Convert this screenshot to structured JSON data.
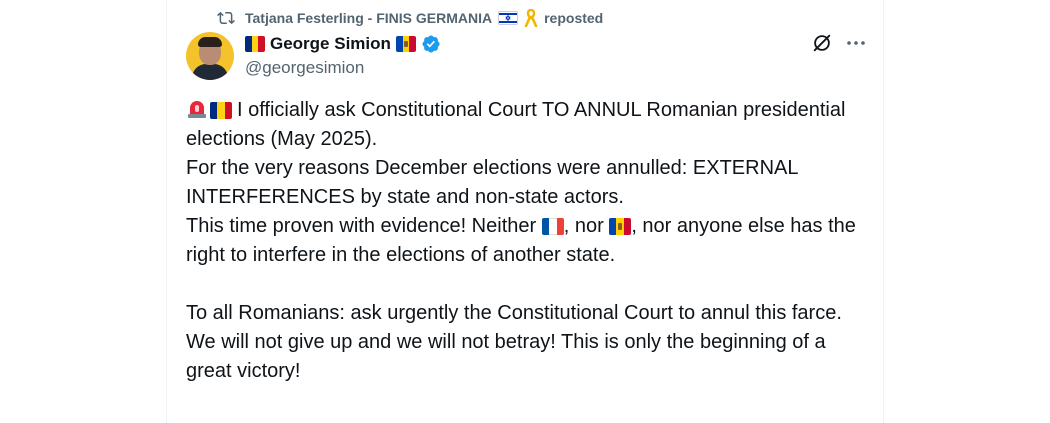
{
  "repost": {
    "user": "Tatjana Festerling - FINIS GERMANIA",
    "suffix": "reposted",
    "icon": "repost-icon"
  },
  "author": {
    "name": "George Simion",
    "handle": "@georgesimion",
    "verified_color": "#1d9bf0"
  },
  "actions": {
    "grok_icon": "grok-icon",
    "more_icon": "more-icon"
  },
  "tweet": {
    "line1": "I officially ask Constitutional Court TO ANNUL Romanian presidential elections (May 2025).",
    "line2": "For the very reasons December elections were annulled: EXTERNAL INTERFERENCES by state and non-state actors.",
    "line3a": "This time proven with evidence! Neither",
    "line3b": ", nor",
    "line3c": ", nor anyone else has the right to interfere in the elections of another state.",
    "line4": "To all Romanians: ask urgently the Constitutional Court to annul this farce.",
    "line5": "We will not give up and we will not betray! This is only the beginning of a great victory!"
  },
  "colors": {
    "text": "#0f1419",
    "secondary": "#536471",
    "border": "#eff3f4",
    "romania_flag": [
      "#002b7f",
      "#fcd116",
      "#ce1126"
    ],
    "france_flag": [
      "#0055a4",
      "#ffffff",
      "#ef4135"
    ],
    "moldova_flag": [
      "#0046ae",
      "#ffd200",
      "#cc092f"
    ]
  }
}
